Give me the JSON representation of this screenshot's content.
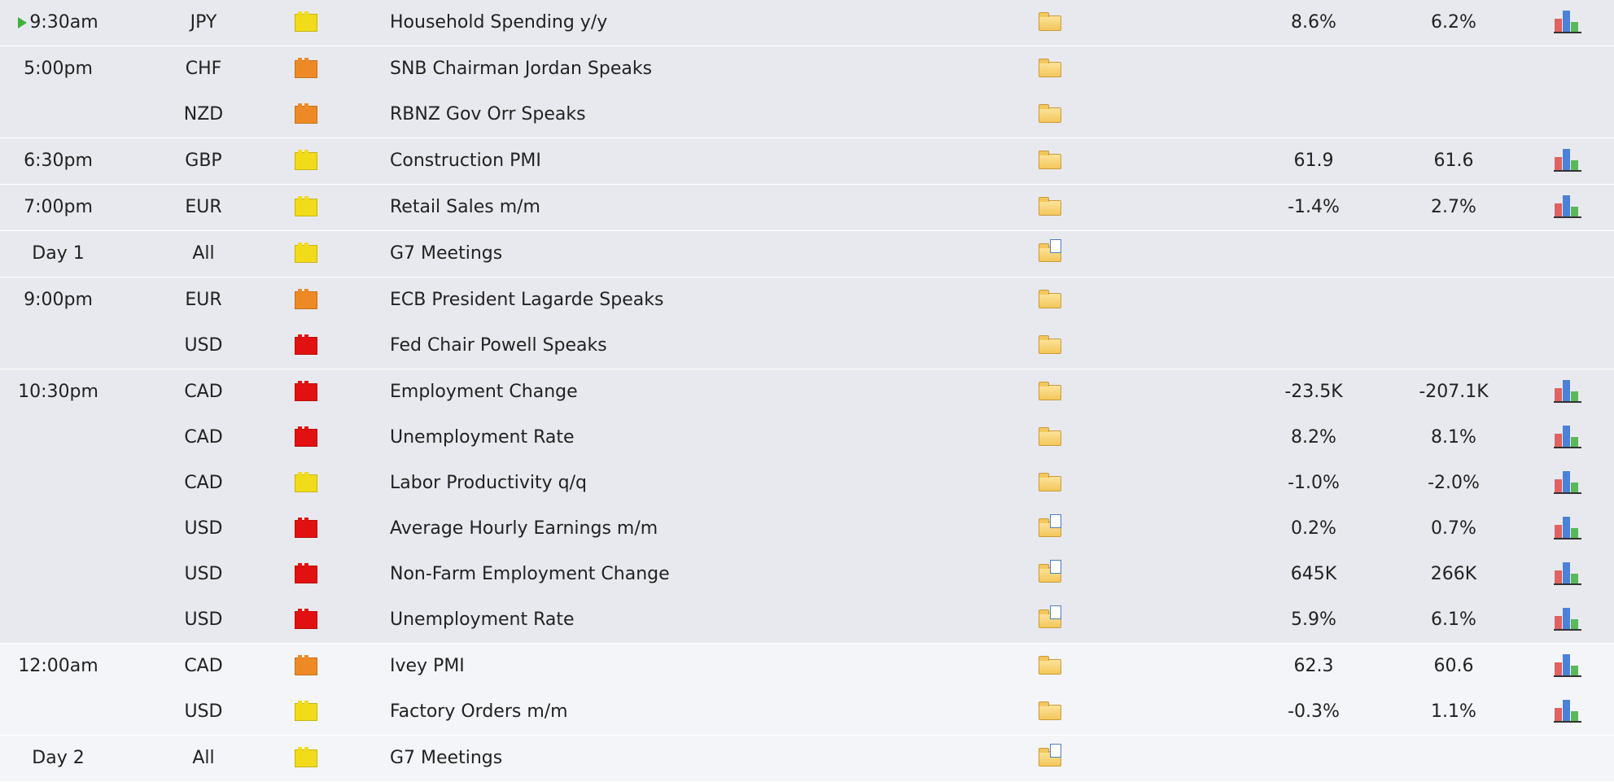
{
  "groups": [
    {
      "shade": "dark",
      "rows": [
        {
          "time": "9:30am",
          "current": true,
          "currency": "JPY",
          "impact": "y",
          "event": "Household Spending y/y",
          "detail": "folder",
          "actual": "8.6%",
          "forecast": "6.2%",
          "graph": true
        }
      ]
    },
    {
      "shade": "dark",
      "rows": [
        {
          "time": "5:00pm",
          "currency": "CHF",
          "impact": "o",
          "event": "SNB Chairman Jordan Speaks",
          "detail": "folder",
          "actual": "",
          "forecast": "",
          "graph": false
        },
        {
          "time": "",
          "currency": "NZD",
          "impact": "o",
          "event": "RBNZ Gov Orr Speaks",
          "detail": "folder",
          "actual": "",
          "forecast": "",
          "graph": false
        }
      ]
    },
    {
      "shade": "dark",
      "rows": [
        {
          "time": "6:30pm",
          "currency": "GBP",
          "impact": "y",
          "event": "Construction PMI",
          "detail": "folder",
          "actual": "61.9",
          "forecast": "61.6",
          "graph": true
        }
      ]
    },
    {
      "shade": "dark",
      "rows": [
        {
          "time": "7:00pm",
          "currency": "EUR",
          "impact": "y",
          "event": "Retail Sales m/m",
          "detail": "folder",
          "actual": "-1.4%",
          "forecast": "2.7%",
          "graph": true
        }
      ]
    },
    {
      "shade": "dark",
      "rows": [
        {
          "time": "Day 1",
          "currency": "All",
          "impact": "y",
          "event": "G7 Meetings",
          "detail": "folder-doc",
          "actual": "",
          "forecast": "",
          "graph": false
        }
      ]
    },
    {
      "shade": "dark",
      "rows": [
        {
          "time": "9:00pm",
          "currency": "EUR",
          "impact": "o",
          "event": "ECB President Lagarde Speaks",
          "detail": "folder",
          "actual": "",
          "forecast": "",
          "graph": false
        },
        {
          "time": "",
          "currency": "USD",
          "impact": "r",
          "event": "Fed Chair Powell Speaks",
          "detail": "folder",
          "actual": "",
          "forecast": "",
          "graph": false
        }
      ]
    },
    {
      "shade": "dark",
      "rows": [
        {
          "time": "10:30pm",
          "currency": "CAD",
          "impact": "r",
          "event": "Employment Change",
          "detail": "folder",
          "actual": "-23.5K",
          "forecast": "-207.1K",
          "graph": true
        },
        {
          "time": "",
          "currency": "CAD",
          "impact": "r",
          "event": "Unemployment Rate",
          "detail": "folder",
          "actual": "8.2%",
          "forecast": "8.1%",
          "graph": true
        },
        {
          "time": "",
          "currency": "CAD",
          "impact": "y",
          "event": "Labor Productivity q/q",
          "detail": "folder",
          "actual": "-1.0%",
          "forecast": "-2.0%",
          "graph": true
        },
        {
          "time": "",
          "currency": "USD",
          "impact": "r",
          "event": "Average Hourly Earnings m/m",
          "detail": "folder-doc",
          "actual": "0.2%",
          "forecast": "0.7%",
          "graph": true
        },
        {
          "time": "",
          "currency": "USD",
          "impact": "r",
          "event": "Non-Farm Employment Change",
          "detail": "folder-doc",
          "actual": "645K",
          "forecast": "266K",
          "graph": true
        },
        {
          "time": "",
          "currency": "USD",
          "impact": "r",
          "event": "Unemployment Rate",
          "detail": "folder-doc",
          "actual": "5.9%",
          "forecast": "6.1%",
          "graph": true
        }
      ]
    },
    {
      "shade": "light",
      "rows": [
        {
          "time": "12:00am",
          "currency": "CAD",
          "impact": "o",
          "event": "Ivey PMI",
          "detail": "folder",
          "actual": "62.3",
          "forecast": "60.6",
          "graph": true
        },
        {
          "time": "",
          "currency": "USD",
          "impact": "y",
          "event": "Factory Orders m/m",
          "detail": "folder",
          "actual": "-0.3%",
          "forecast": "1.1%",
          "graph": true
        }
      ]
    },
    {
      "shade": "light",
      "rows": [
        {
          "time": "Day 2",
          "currency": "All",
          "impact": "y",
          "event": "G7 Meetings",
          "detail": "folder-doc",
          "actual": "",
          "forecast": "",
          "graph": false
        }
      ]
    }
  ],
  "impact_colors": {
    "y": "#f2dc1a",
    "o": "#ee8a26",
    "r": "#e21111"
  },
  "icons": {
    "impact": "impact-flag-icon",
    "detail": "folder-icon",
    "graph": "bar-chart-icon",
    "current": "play-arrow-icon"
  }
}
